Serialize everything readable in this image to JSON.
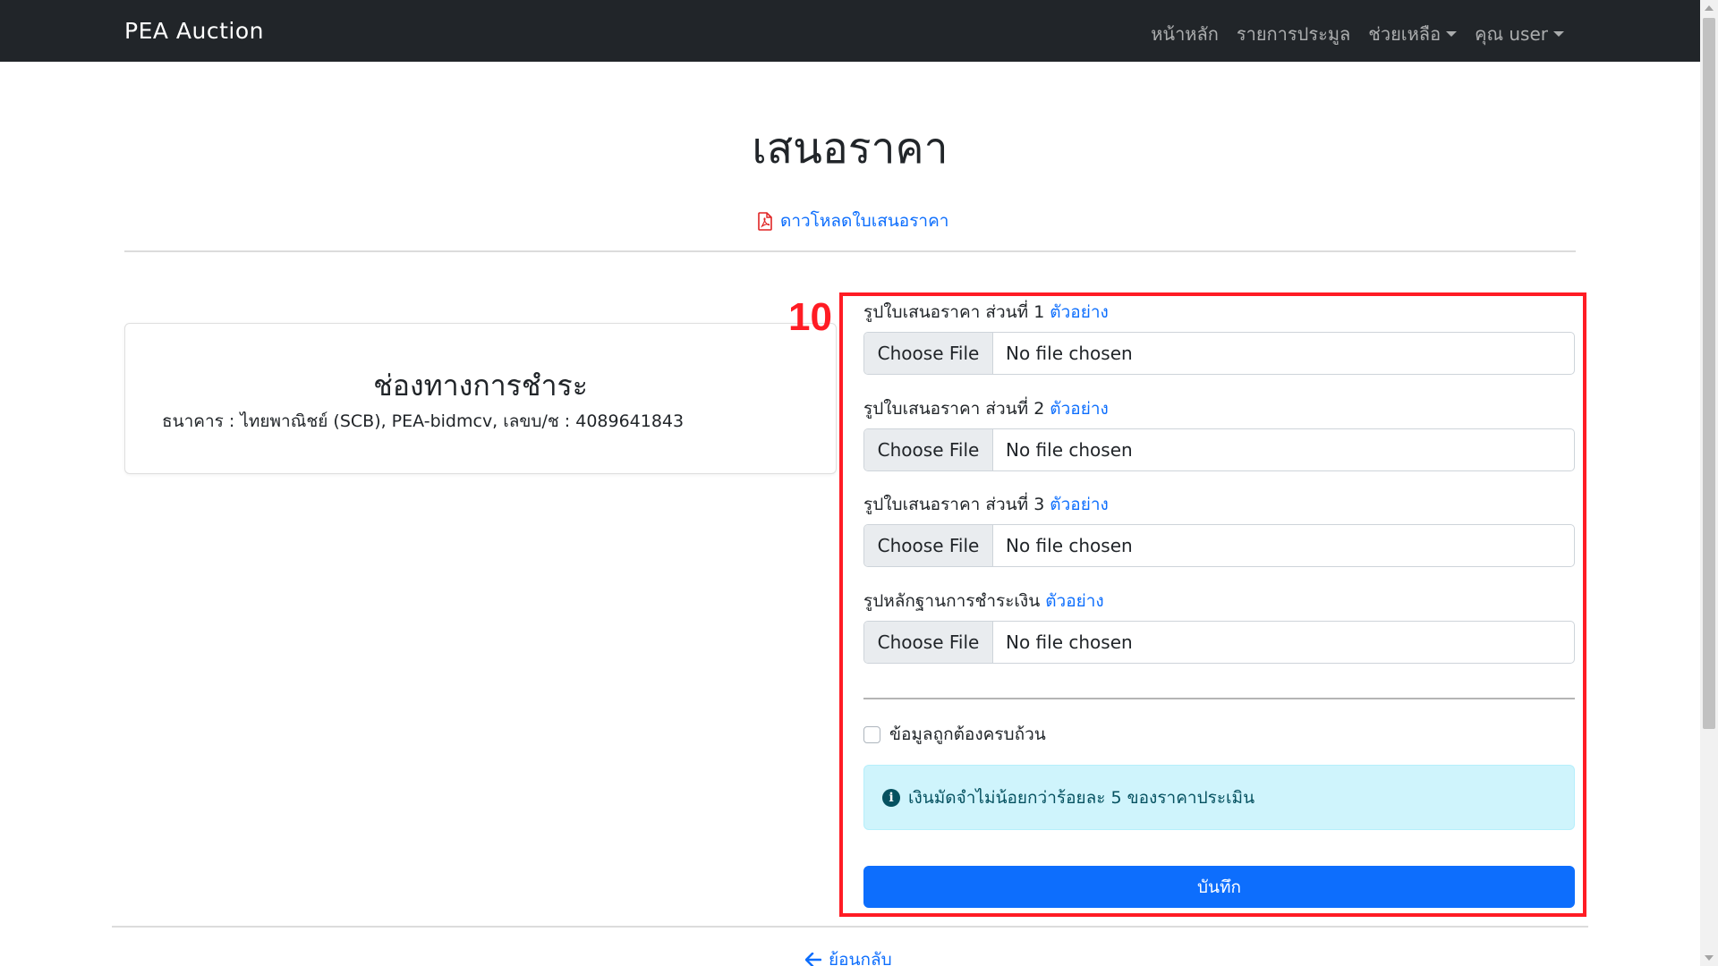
{
  "navbar": {
    "brand": "PEA Auction",
    "links": {
      "home": "หน้าหลัก",
      "auction_list": "รายการประมูล",
      "help": "ช่วยเหลือ",
      "user": "คุณ user"
    }
  },
  "page": {
    "title": "เสนอราคา",
    "download_link": "ดาวโหลดใบเสนอราคา",
    "download_icon": "file-pdf-icon"
  },
  "payment": {
    "title": "ช่องทางการชำระ",
    "detail": "ธนาคาร : ไทยพาณิชย์ (SCB), PEA-bidmcv, เลขบ/ช : 4089641843"
  },
  "annotation": {
    "number": "10",
    "color": "#ff1c24"
  },
  "form": {
    "fields": [
      {
        "label": "รูปใบเสนอราคา ส่วนที่ 1",
        "example": "ตัวอย่าง",
        "button": "Choose File",
        "status": "No file chosen"
      },
      {
        "label": "รูปใบเสนอราคา ส่วนที่ 2",
        "example": "ตัวอย่าง",
        "button": "Choose File",
        "status": "No file chosen"
      },
      {
        "label": "รูปใบเสนอราคา ส่วนที่ 3",
        "example": "ตัวอย่าง",
        "button": "Choose File",
        "status": "No file chosen"
      },
      {
        "label": "รูปหลักฐานการชำระเงิน",
        "example": "ตัวอย่าง",
        "button": "Choose File",
        "status": "No file chosen"
      }
    ],
    "confirm_label": "ข้อมูลถูกต้องครบถ้วน",
    "info_text": "เงินมัดจำไม่น้อยกว่าร้อยละ 5 ของราคาประเมิน",
    "save_label": "บันทึก"
  },
  "footer": {
    "back_label": "ย้อนกลับ"
  },
  "colors": {
    "navbar_bg": "#212529",
    "primary": "#0d6efd",
    "info_bg": "#cff4fc",
    "info_text": "#055160"
  }
}
